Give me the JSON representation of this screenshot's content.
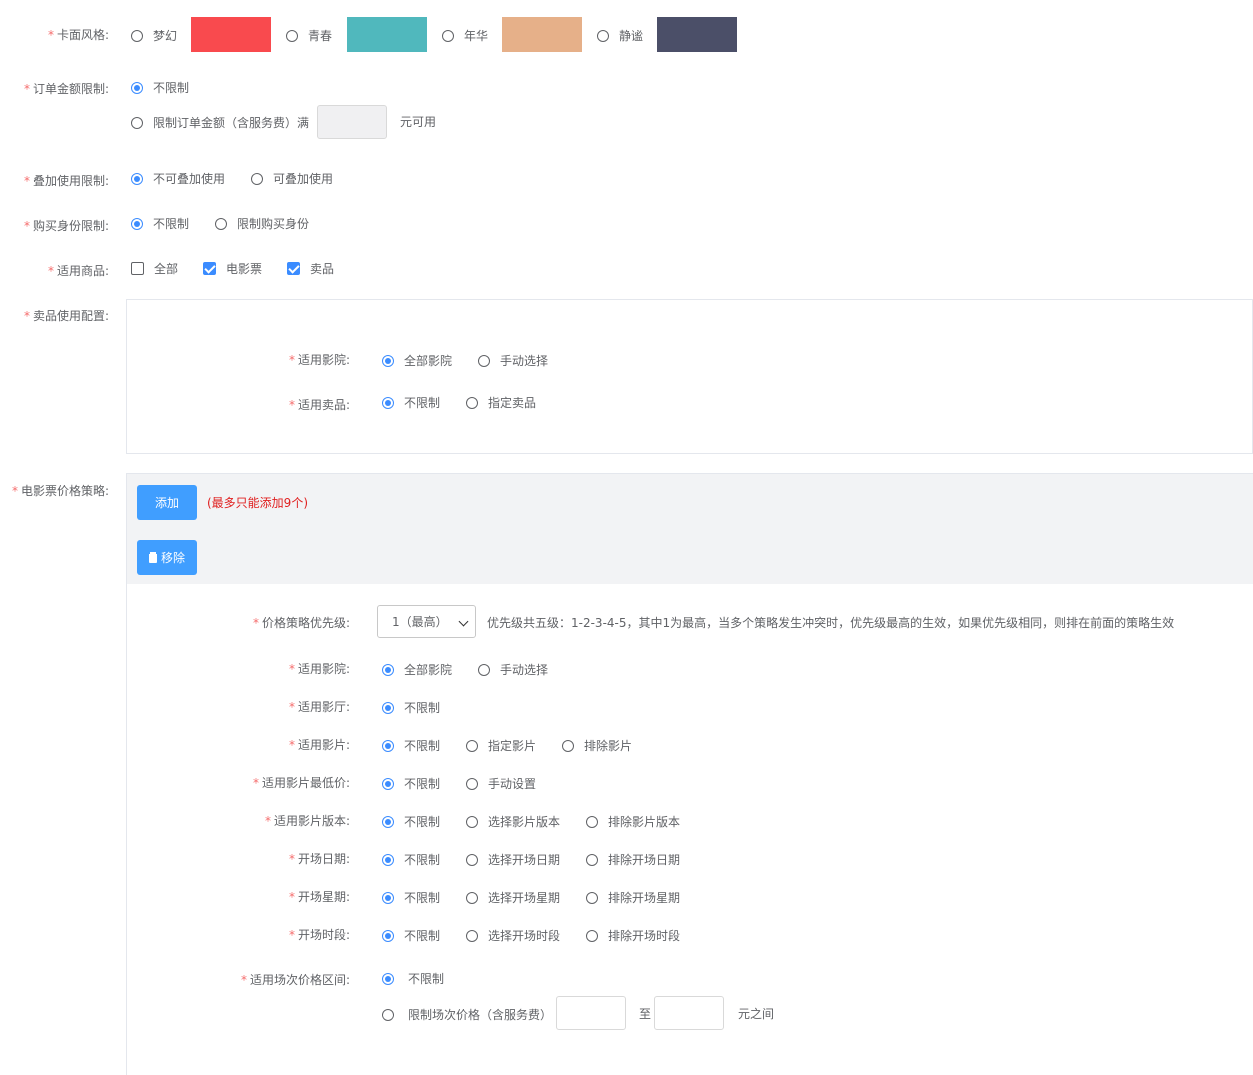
{
  "card_style": {
    "label": "卡面风格:",
    "options": [
      {
        "label": "梦幻",
        "color": "#f94a4e"
      },
      {
        "label": "青春",
        "color": "#50b8bd"
      },
      {
        "label": "年华",
        "color": "#e6b089"
      },
      {
        "label": "静谧",
        "color": "#4b4f68"
      }
    ]
  },
  "order_amount": {
    "label": "订单金额限制:",
    "opt_unlimited": "不限制",
    "opt_limited": "限制订单金额（含服务费）满",
    "suffix": "元可用"
  },
  "stack_limit": {
    "label": "叠加使用限制:",
    "opt_no": "不可叠加使用",
    "opt_yes": "可叠加使用"
  },
  "buyer_limit": {
    "label": "购买身份限制:",
    "opt_unlimited": "不限制",
    "opt_limited": "限制购买身份"
  },
  "goods": {
    "label": "适用商品:",
    "all": "全部",
    "movie_ticket": "电影票",
    "snack": "卖品"
  },
  "snack_config": {
    "label": "卖品使用配置:",
    "cinema_label": "适用影院:",
    "cinema_all": "全部影院",
    "cinema_manual": "手动选择",
    "snack_label": "适用卖品:",
    "snack_unlimited": "不限制",
    "snack_specified": "指定卖品"
  },
  "ticket_strategy": {
    "label": "电影票价格策略:",
    "add_button": "添加",
    "add_hint": "(最多只能添加9个)",
    "remove_button": "移除",
    "priority_label": "价格策略优先级:",
    "priority_value": "1（最高）",
    "priority_hint": "优先级共五级：1-2-3-4-5，其中1为最高，当多个策略发生冲突时，优先级最高的生效，如果优先级相同，则排在前面的策略生效",
    "cinema_label": "适用影院:",
    "cinema_all": "全部影院",
    "cinema_manual": "手动选择",
    "hall_label": "适用影厅:",
    "hall_unlimited": "不限制",
    "film_label": "适用影片:",
    "film_unlimited": "不限制",
    "film_specified": "指定影片",
    "film_excluded": "排除影片",
    "min_price_label": "适用影片最低价:",
    "min_price_unlimited": "不限制",
    "min_price_manual": "手动设置",
    "version_label": "适用影片版本:",
    "version_unlimited": "不限制",
    "version_select": "选择影片版本",
    "version_exclude": "排除影片版本",
    "date_label": "开场日期:",
    "date_unlimited": "不限制",
    "date_select": "选择开场日期",
    "date_exclude": "排除开场日期",
    "week_label": "开场星期:",
    "week_unlimited": "不限制",
    "week_select": "选择开场星期",
    "week_exclude": "排除开场星期",
    "period_label": "开场时段:",
    "period_unlimited": "不限制",
    "period_select": "选择开场时段",
    "period_exclude": "排除开场时段",
    "range_label": "适用场次价格区间:",
    "range_unlimited": "不限制",
    "range_limited": "限制场次价格（含服务费）",
    "range_to": "至",
    "range_suffix": "元之间"
  }
}
